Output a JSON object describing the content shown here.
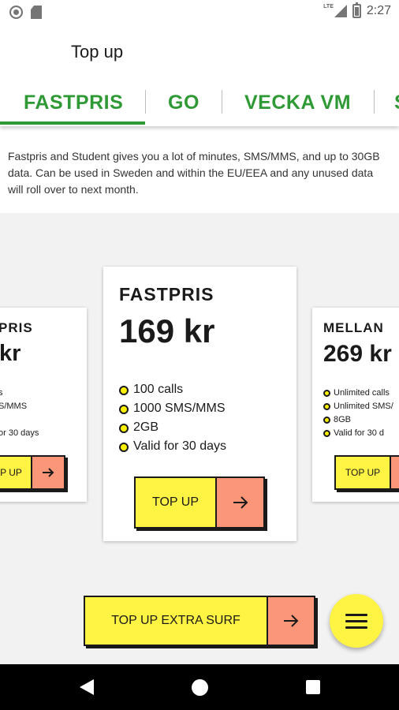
{
  "status_bar": {
    "network": "LTE",
    "time": "2:27"
  },
  "header": {
    "title": "Top up"
  },
  "tabs": [
    {
      "label": "FASTPRIS",
      "selected": true
    },
    {
      "label": "GO",
      "selected": false
    },
    {
      "label": "VECKA VM",
      "selected": false
    },
    {
      "label": "S",
      "selected": false
    }
  ],
  "description": "Fastpris and Student gives you a lot of minutes, SMS/MMS, and up to 30GB data. Can be used in Sweden and within the EU/EEA and any unused data will roll over to next month.",
  "cards": {
    "left": {
      "name": "PRIS",
      "price": "kr",
      "features": [
        "s",
        "S/MMS",
        "",
        "or 30 days"
      ],
      "button": "P UP"
    },
    "center": {
      "name": "FASTPRIS",
      "price": "169 kr",
      "features": [
        "100 calls",
        "1000 SMS/MMS",
        "2GB",
        "Valid for 30 days"
      ],
      "button": "TOP UP"
    },
    "right": {
      "name": "MELLAN",
      "price": "269 kr",
      "features": [
        "Unlimited calls",
        "Unlimited SMS/",
        "8GB",
        "Valid for 30 d"
      ],
      "button": "TOP UP"
    }
  },
  "extra_surf_button": "TOP UP EXTRA SURF",
  "icons": {
    "arrow": "arrow-right-icon",
    "menu": "menu-icon",
    "nav_back": "back-icon",
    "nav_home": "home-icon",
    "nav_recents": "recents-icon"
  },
  "colors": {
    "brand_green": "#2f9a35",
    "yellow": "#fff343",
    "salmon": "#fc9679"
  }
}
